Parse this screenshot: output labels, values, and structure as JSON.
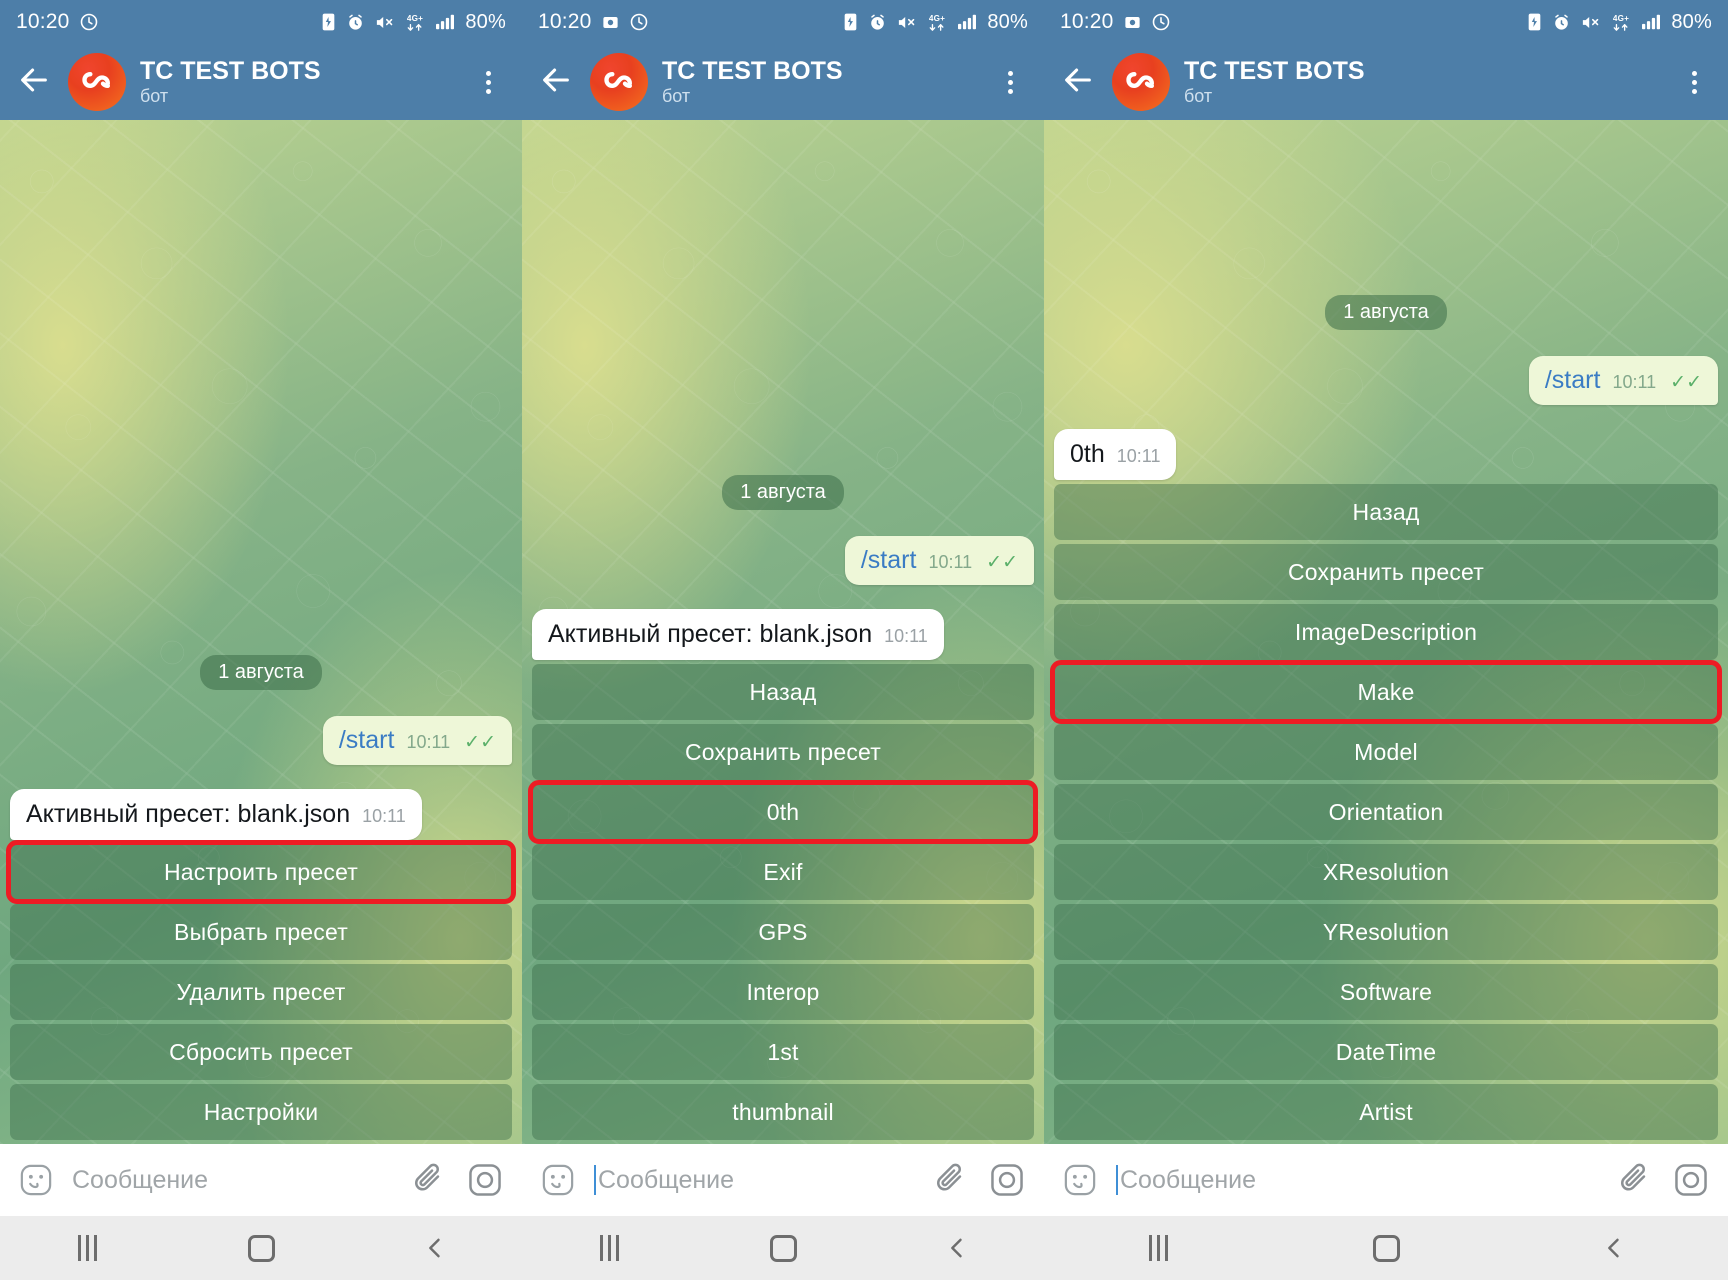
{
  "app": {
    "chat_title": "TC TEST BOTS",
    "chat_subtitle": "бот",
    "avatar_icon": "infinity-logo-icon",
    "back_icon": "arrow-left-icon",
    "menu_icon": "kebab-menu-icon",
    "accent_header": "#4d7ea8",
    "highlight_color": "#ed1c24",
    "outgoing_bubble_color": "#eef7d8",
    "incoming_bubble_color": "#ffffff"
  },
  "status_bar": {
    "time": "10:20",
    "icons_left": [
      "screenshot-icon",
      "clock-check-icon"
    ],
    "icons_right": [
      "battery-saver-icon",
      "alarm-icon",
      "mute-icon",
      "4g-plus-icon",
      "signal-bars-icon"
    ],
    "battery": "80%"
  },
  "composer": {
    "placeholder": "Сообщение",
    "emoji_icon": "smiley-icon",
    "attach_icon": "paperclip-icon",
    "camera_icon": "camera-icon"
  },
  "nav_bar": {
    "recents_icon": "recents-icon",
    "home_icon": "home-icon",
    "back_icon": "back-chevron-icon"
  },
  "panels": [
    {
      "id": "panel-preset-menu",
      "day_chip": "1 августа",
      "outgoing": {
        "text": "/start",
        "time": "10:11",
        "status": "✓✓"
      },
      "incoming": {
        "text": "Активный пресет: blank.json",
        "time": "10:11"
      },
      "keyboard": [
        {
          "label": "Настроить пресет",
          "highlighted": true
        },
        {
          "label": "Выбрать пресет",
          "highlighted": false
        },
        {
          "label": "Удалить пресет",
          "highlighted": false
        },
        {
          "label": "Сбросить пресет",
          "highlighted": false
        },
        {
          "label": "Настройки",
          "highlighted": false
        }
      ]
    },
    {
      "id": "panel-ifd-menu",
      "day_chip": "1 августа",
      "outgoing": {
        "text": "/start",
        "time": "10:11",
        "status": "✓✓"
      },
      "incoming": {
        "text": "Активный пресет: blank.json",
        "time": "10:11"
      },
      "keyboard": [
        {
          "label": "Назад",
          "highlighted": false
        },
        {
          "label": "Сохранить пресет",
          "highlighted": false
        },
        {
          "label": "0th",
          "highlighted": true
        },
        {
          "label": "Exif",
          "highlighted": false
        },
        {
          "label": "GPS",
          "highlighted": false
        },
        {
          "label": "Interop",
          "highlighted": false
        },
        {
          "label": "1st",
          "highlighted": false
        },
        {
          "label": "thumbnail",
          "highlighted": false
        }
      ]
    },
    {
      "id": "panel-0th-tags",
      "day_chip": "1 августа",
      "outgoing": {
        "text": "/start",
        "time": "10:11",
        "status": "✓✓"
      },
      "incoming": {
        "text": "0th",
        "time": "10:11"
      },
      "keyboard": [
        {
          "label": "Назад",
          "highlighted": false
        },
        {
          "label": "Сохранить пресет",
          "highlighted": false
        },
        {
          "label": "ImageDescription",
          "highlighted": false
        },
        {
          "label": "Make",
          "highlighted": true
        },
        {
          "label": "Model",
          "highlighted": false
        },
        {
          "label": "Orientation",
          "highlighted": false
        },
        {
          "label": "XResolution",
          "highlighted": false
        },
        {
          "label": "YResolution",
          "highlighted": false
        },
        {
          "label": "Software",
          "highlighted": false
        },
        {
          "label": "DateTime",
          "highlighted": false
        },
        {
          "label": "Artist",
          "highlighted": false
        }
      ]
    }
  ]
}
